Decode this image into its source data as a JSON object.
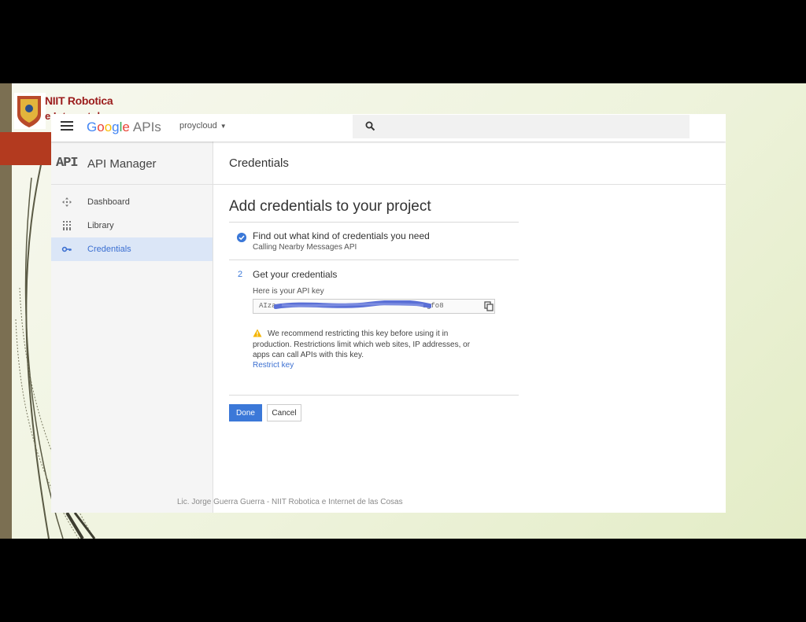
{
  "slide": {
    "logo_title": "NIIT Robotica",
    "logo_sub": "e Internet de",
    "footer": "Lic. Jorge Guerra Guerra - NIIT Robotica e Internet de las Cosas"
  },
  "topbar": {
    "brand_google": [
      "G",
      "o",
      "o",
      "g",
      "l",
      "e"
    ],
    "brand_apis": "APIs",
    "project": "proycloud",
    "search_placeholder": ""
  },
  "sidebar": {
    "logo": "API",
    "title": "API Manager",
    "items": [
      {
        "label": "Dashboard",
        "icon": "dashboard-icon"
      },
      {
        "label": "Library",
        "icon": "library-icon"
      },
      {
        "label": "Credentials",
        "icon": "key-icon",
        "active": true
      }
    ]
  },
  "main": {
    "header": "Credentials",
    "heading": "Add credentials to your project",
    "step1": {
      "title": "Find out what kind of credentials you need",
      "subtitle": "Calling Nearby Messages API"
    },
    "step2": {
      "number": "2",
      "title": "Get your credentials",
      "key_label": "Here is your API key",
      "key_value": "AIza",
      "key_suffix": "Sgfo8",
      "warning": "We recommend restricting this key before using it in production. Restrictions limit which web sites, IP addresses, or apps can call APIs with this key.",
      "restrict_link": "Restrict key"
    },
    "done_label": "Done",
    "cancel_label": "Cancel"
  },
  "colors": {
    "accent": "#3b78d8",
    "active_bg": "#dbe6f7",
    "warning": "#f4b400"
  }
}
